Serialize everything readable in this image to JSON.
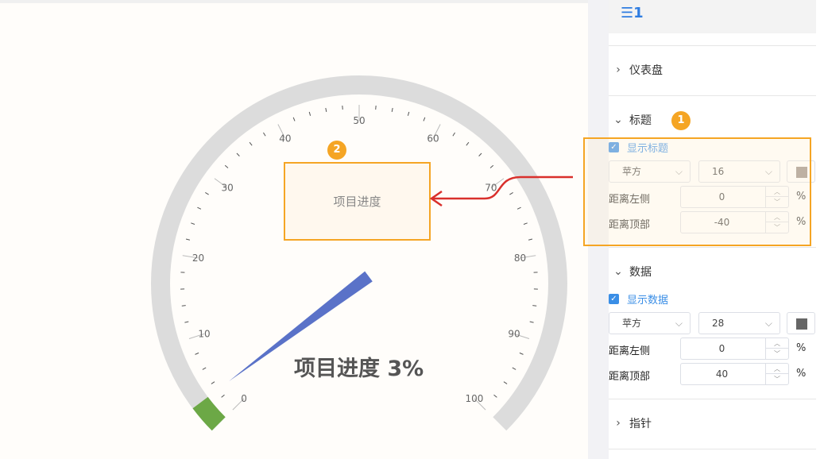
{
  "gauge": {
    "min": 0,
    "max": 100,
    "value": 3,
    "tick_labels": [
      "0",
      "10",
      "20",
      "30",
      "40",
      "50",
      "60",
      "70",
      "80",
      "90",
      "100"
    ],
    "title": "项目进度",
    "value_text": "项目进度 3%",
    "track_color": "#dcdcdc",
    "progress_color": "#6ca846",
    "pointer_color": "#5a72c8"
  },
  "annotations": {
    "badge_1": "1",
    "badge_2": "2",
    "accent_color": "#f5a524",
    "arrow_color": "#d9302c"
  },
  "panel": {
    "header_icon": "list-order-icon",
    "header_icon_glyph": "☰1",
    "sections": {
      "gauge": {
        "label": "仪表盘"
      },
      "title": {
        "label": "标题",
        "show_label": "显示标题",
        "font": "苹方",
        "font_size": "16",
        "color": "#9c9088",
        "left_label": "距离左侧",
        "left_value": "0",
        "top_label": "距离顶部",
        "top_value": "-40",
        "unit": "%"
      },
      "data": {
        "label": "数据",
        "show_label": "显示数据",
        "font": "苹方",
        "font_size": "28",
        "color": "#666666",
        "left_label": "距离左侧",
        "left_value": "0",
        "top_label": "距离顶部",
        "top_value": "40",
        "unit": "%"
      },
      "pointer": {
        "label": "指针"
      }
    }
  }
}
